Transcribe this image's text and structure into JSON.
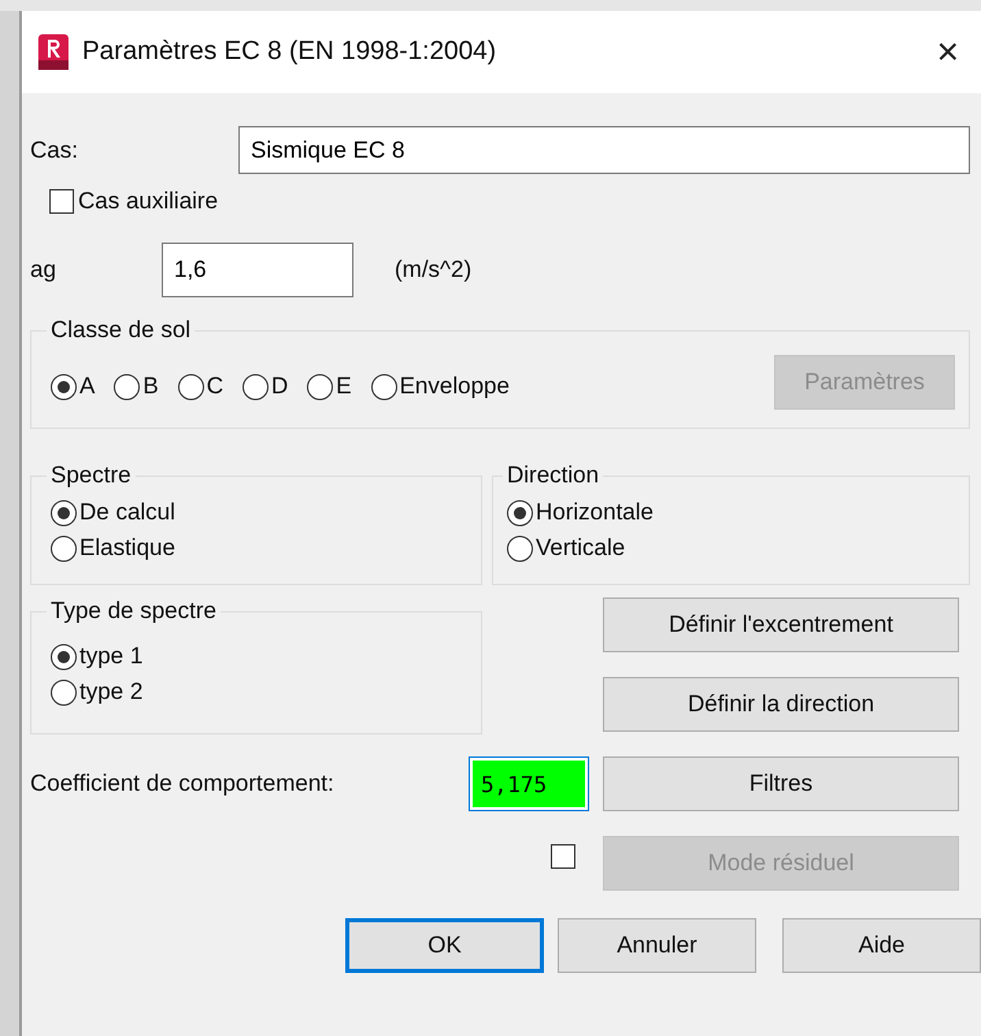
{
  "window": {
    "title": "Paramètres EC 8 (EN 1998-1:2004)",
    "close": "×"
  },
  "case": {
    "label": "Cas:",
    "value": "Sismique EC 8"
  },
  "auxiliary": {
    "label": "Cas auxiliaire",
    "checked": false
  },
  "ag": {
    "label": "ag",
    "value": "1,6",
    "unit": "(m/s^2)"
  },
  "soil_class": {
    "title": "Classe de sol",
    "options": [
      {
        "label": "A",
        "selected": true
      },
      {
        "label": "B",
        "selected": false
      },
      {
        "label": "C",
        "selected": false
      },
      {
        "label": "D",
        "selected": false
      },
      {
        "label": "E",
        "selected": false
      },
      {
        "label": "Enveloppe",
        "selected": false
      }
    ],
    "button": {
      "label": "Paramètres",
      "disabled": true
    }
  },
  "spectrum": {
    "title": "Spectre",
    "options": [
      {
        "label": "De calcul",
        "selected": true
      },
      {
        "label": "Elastique",
        "selected": false
      }
    ]
  },
  "direction": {
    "title": "Direction",
    "options": [
      {
        "label": "Horizontale",
        "selected": true
      },
      {
        "label": "Verticale",
        "selected": false
      }
    ]
  },
  "spectrum_type": {
    "title": "Type de spectre",
    "options": [
      {
        "label": "type 1",
        "selected": true
      },
      {
        "label": "type 2",
        "selected": false
      }
    ]
  },
  "side_buttons": [
    {
      "label": "Définir l'excentrement",
      "disabled": false
    },
    {
      "label": "Définir la direction",
      "disabled": false
    },
    {
      "label": "Filtres",
      "disabled": false
    }
  ],
  "behaviour": {
    "label": "Coefficient de comportement:",
    "value": "5,175",
    "focused": true
  },
  "residual": {
    "checked": false,
    "button": {
      "label": "Mode résiduel",
      "disabled": true
    }
  },
  "footer_buttons": [
    {
      "label": "OK",
      "default": true
    },
    {
      "label": "Annuler",
      "default": false
    },
    {
      "label": "Aide",
      "default": false
    }
  ]
}
